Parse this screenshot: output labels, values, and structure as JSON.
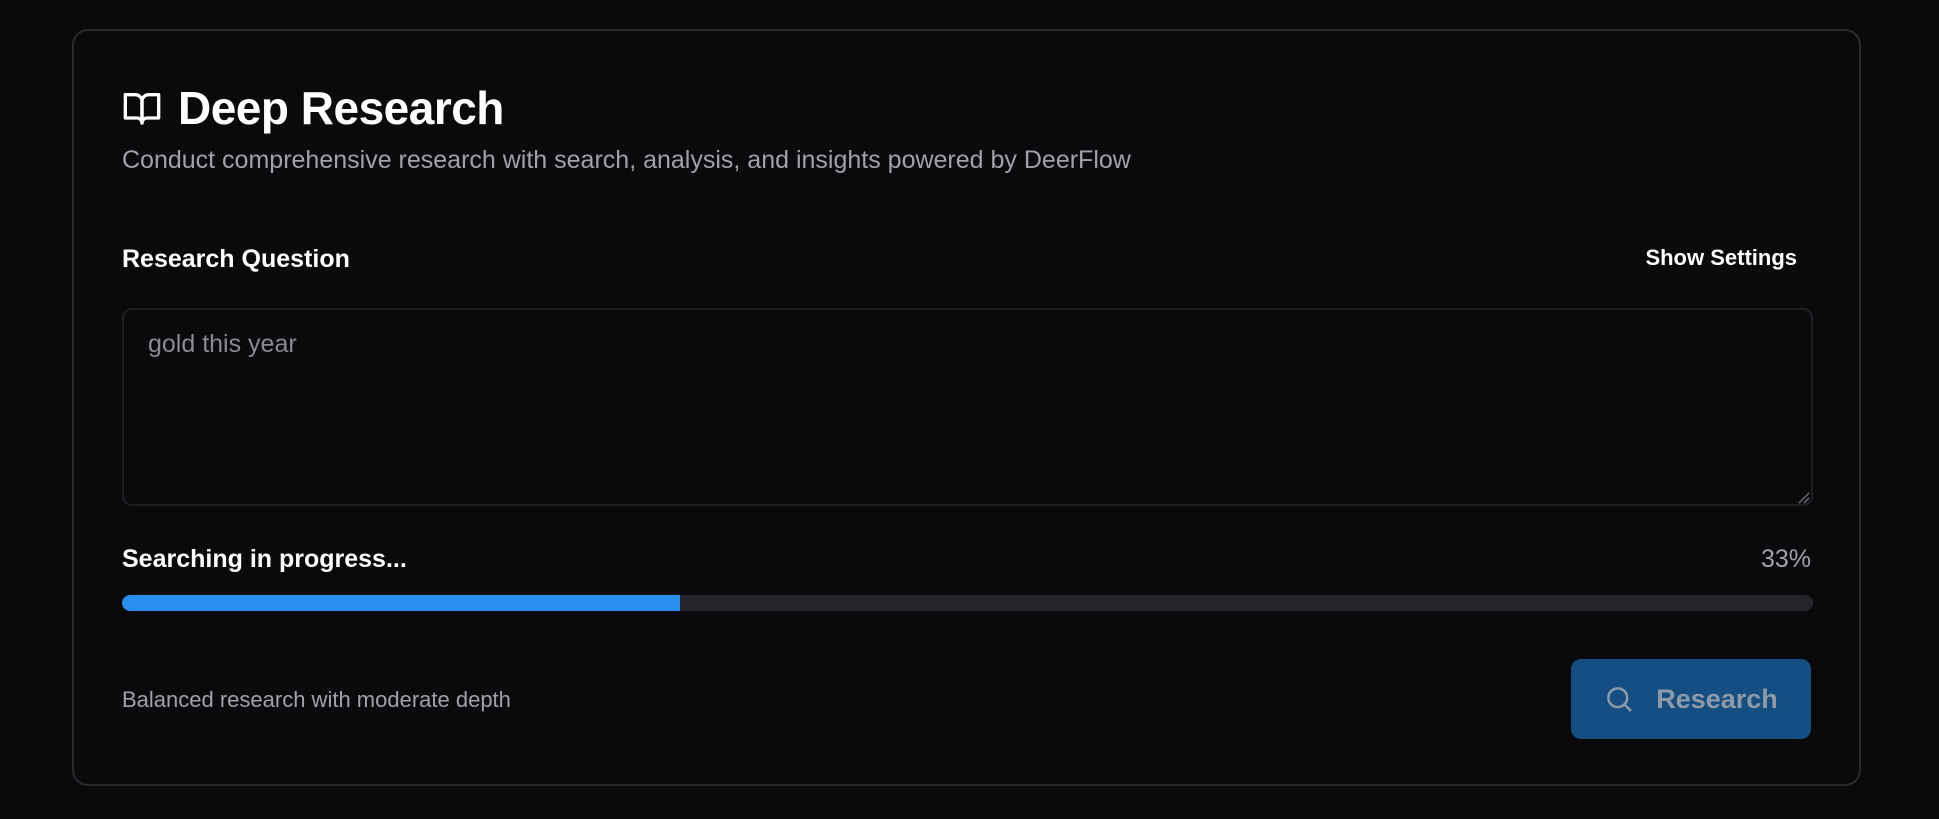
{
  "header": {
    "icon": "book-open-icon",
    "title": "Deep Research",
    "subtitle": "Conduct comprehensive research with search, analysis, and insights powered by DeerFlow"
  },
  "question": {
    "label": "Research Question",
    "value": "gold this year",
    "settings_label": "Show Settings"
  },
  "progress": {
    "status": "Searching in progress...",
    "percent_label": "33%",
    "fill_fraction": 0.33,
    "color": "#2b8ff0"
  },
  "footer": {
    "depth_description": "Balanced research with moderate depth",
    "research_button_label": "Research",
    "research_button_icon": "search-icon",
    "research_button_color": "#144e82"
  }
}
